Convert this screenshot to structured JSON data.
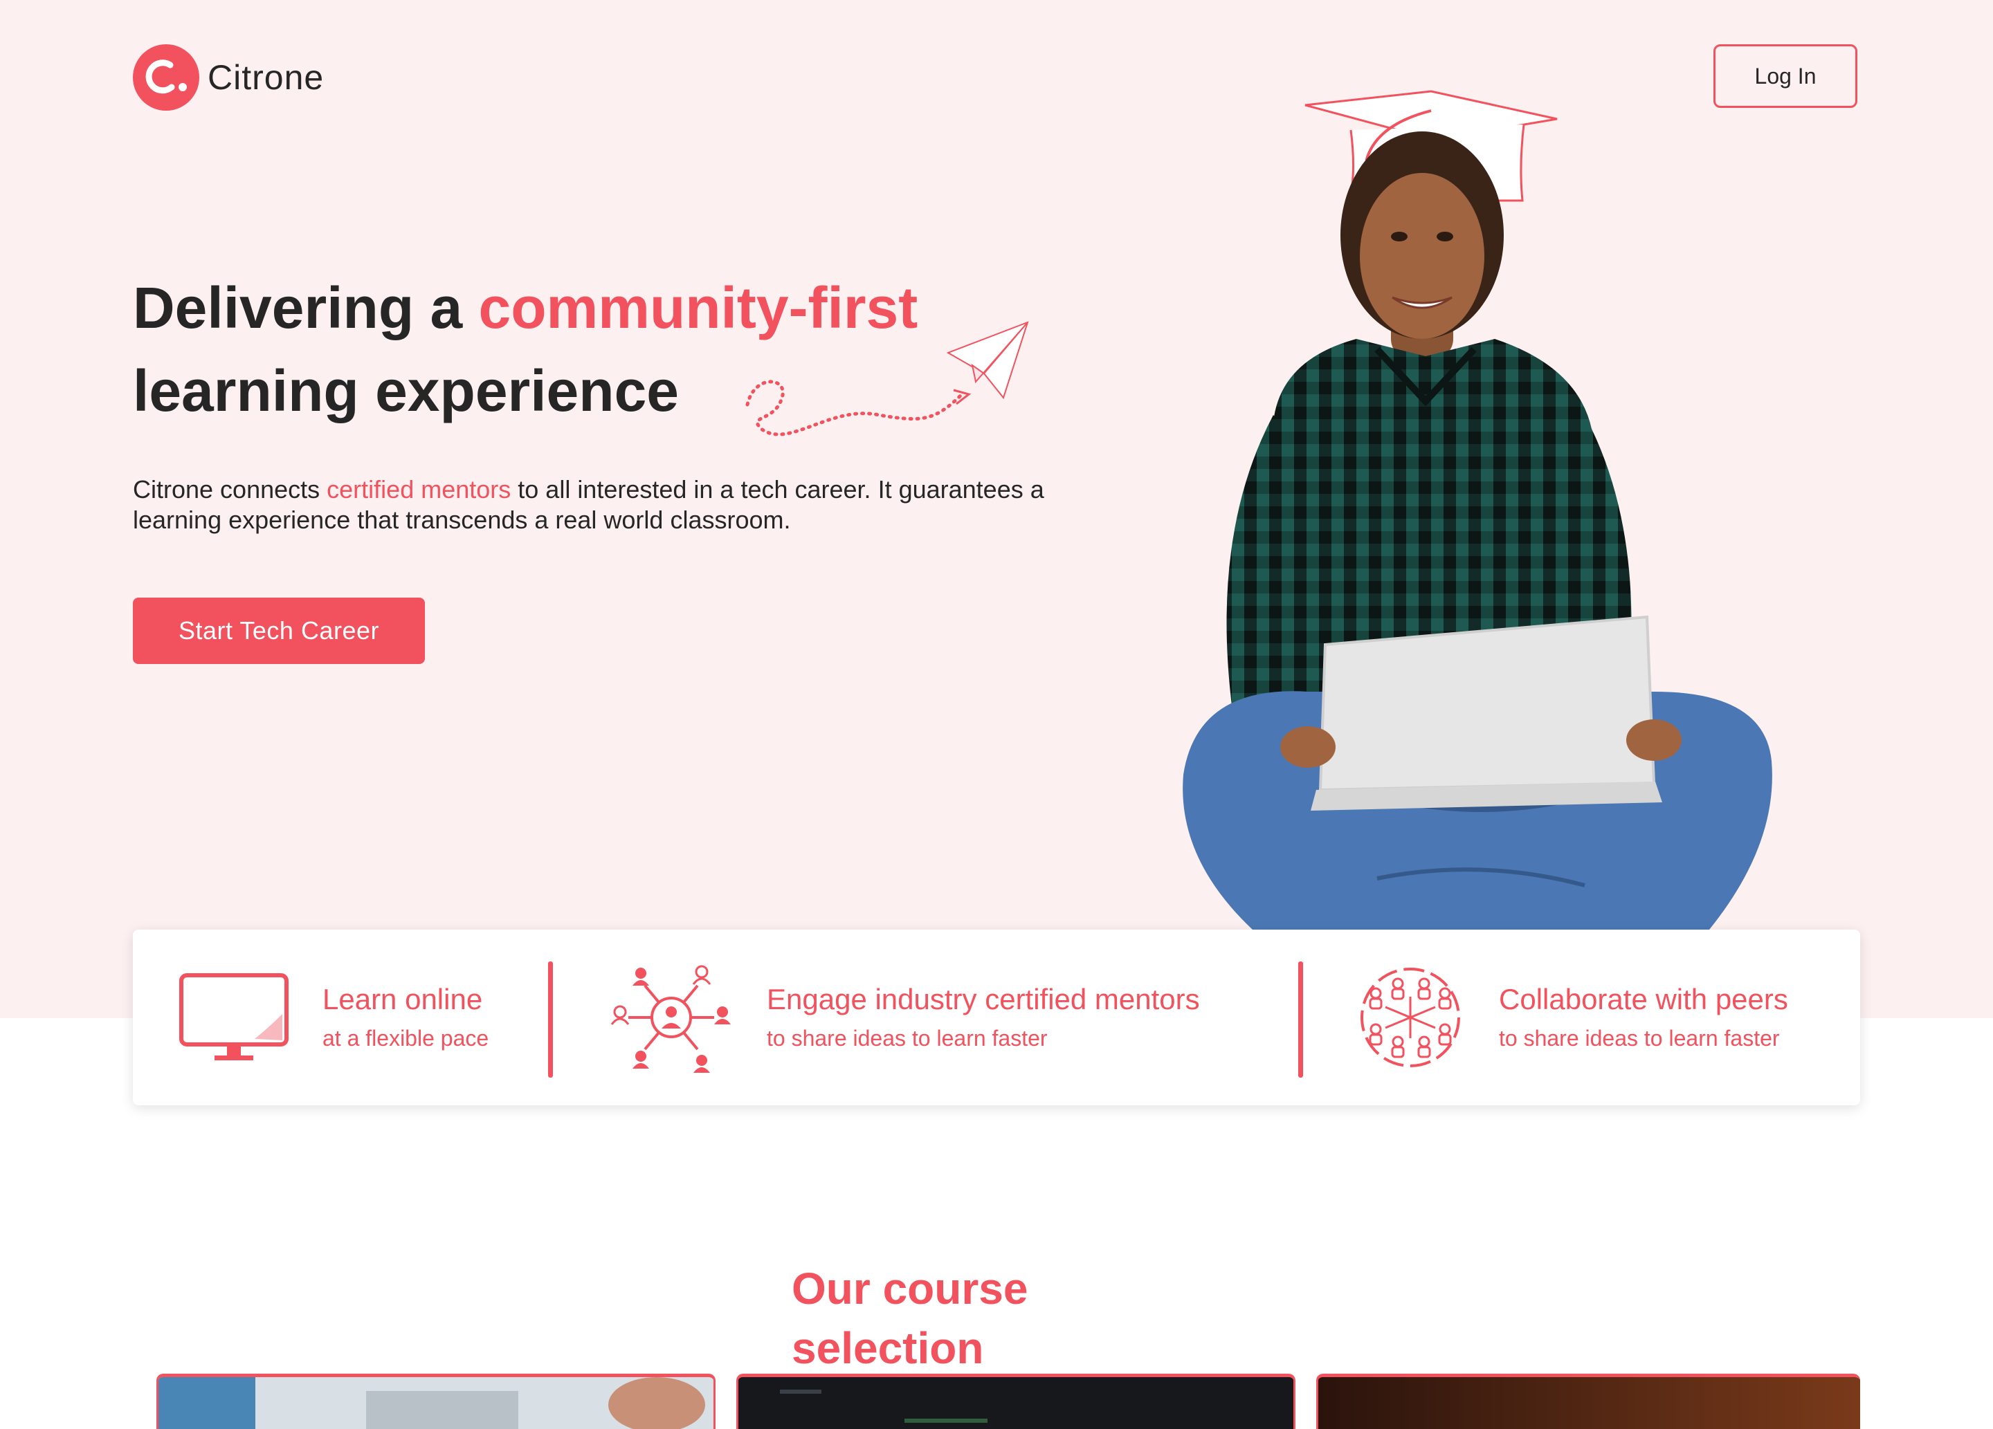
{
  "brand": {
    "name": "Citrone",
    "logo_letter": "c.",
    "accent_color": "#f1525e",
    "hero_bg_color": "#fdf0f1"
  },
  "nav": {
    "login_label": "Log In"
  },
  "hero": {
    "title_part1": "Delivering a ",
    "title_accent": "community-first",
    "title_part2": "learning experience",
    "desc_part1": "Citrone connects ",
    "desc_accent": "certified mentors",
    "desc_part2": " to all interested in a tech career. It guarantees a learning experience that transcends a real world classroom.",
    "cta_label": "Start Tech Career"
  },
  "features": [
    {
      "icon": "monitor-icon",
      "title": "Learn online",
      "subtitle": "at a flexible pace"
    },
    {
      "icon": "mentor-network-icon",
      "title": "Engage industry certified mentors",
      "subtitle": "to share ideas to learn faster"
    },
    {
      "icon": "peers-collaboration-icon",
      "title": "Collaborate with peers",
      "subtitle": "to share ideas to learn faster"
    }
  ],
  "courses": {
    "section_title": "Our course selection"
  }
}
